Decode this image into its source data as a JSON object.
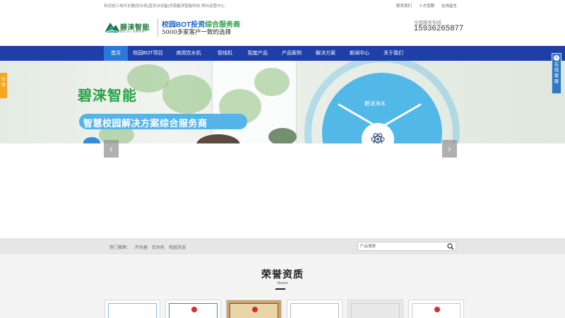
{
  "topbar": {
    "welcome": "欢迎进入电开水器|饮水机|直饮水设备|河南碧涞智能科技-郑州运营中心",
    "links": [
      "联系我们",
      "人才招聘",
      "在线留言"
    ]
  },
  "header": {
    "logo_name": "碧涞智能",
    "logo_sub": "BILAI SMART",
    "slogan_blue": "校园BOT投资",
    "slogan_green": "综合服务商",
    "slogan_line2": "5000多家客户一致的选择",
    "hotline_label": "全国服务热线",
    "hotline": "15936265877"
  },
  "nav": {
    "items": [
      "首页",
      "校园BOT项目",
      "商用饮水机",
      "管线机",
      "配套产品",
      "产品案例",
      "解决方案",
      "新闻中心",
      "关于我们"
    ],
    "active_index": 0
  },
  "banner": {
    "title": "碧涞智能",
    "subtitle": "智慧校园解决方案综合服务商",
    "circle_label": "碧涞净水",
    "prev_arrow": "‹",
    "next_arrow": "›"
  },
  "side": {
    "share": "分享",
    "service": "在线客服"
  },
  "search": {
    "hot_label": "热门搜索：",
    "keywords": [
      "开水器",
      "饮水机",
      "校园洗浴"
    ],
    "placeholder": "产品搜索"
  },
  "honor": {
    "title": "荣誉资质",
    "subtitle": "Honor"
  },
  "colors": {
    "nav_bg": "#1e3fa8",
    "nav_active": "#2c78d8",
    "brand_green": "#27a145",
    "brand_blue": "#1a63c8",
    "banner_blue": "#52b8e8"
  }
}
